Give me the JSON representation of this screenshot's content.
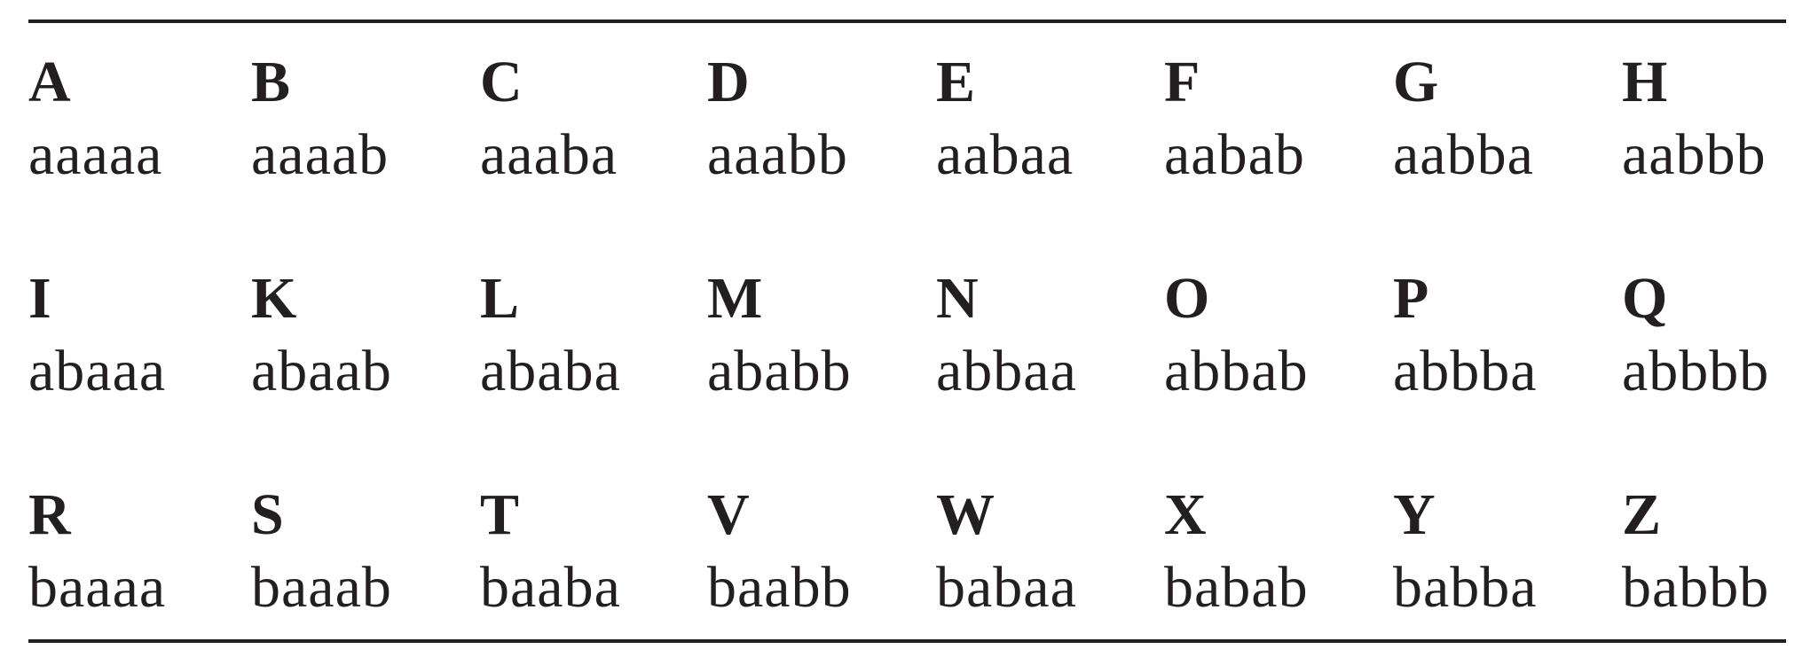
{
  "table": {
    "rows": [
      [
        {
          "letter": "A",
          "code": "aaaaa"
        },
        {
          "letter": "B",
          "code": "aaaab"
        },
        {
          "letter": "C",
          "code": "aaaba"
        },
        {
          "letter": "D",
          "code": "aaabb"
        },
        {
          "letter": "E",
          "code": "aabaa"
        },
        {
          "letter": "F",
          "code": "aabab"
        },
        {
          "letter": "G",
          "code": "aabba"
        },
        {
          "letter": "H",
          "code": "aabbb"
        }
      ],
      [
        {
          "letter": "I",
          "code": "abaaa"
        },
        {
          "letter": "K",
          "code": "abaab"
        },
        {
          "letter": "L",
          "code": "ababa"
        },
        {
          "letter": "M",
          "code": "ababb"
        },
        {
          "letter": "N",
          "code": "abbaa"
        },
        {
          "letter": "O",
          "code": "abbab"
        },
        {
          "letter": "P",
          "code": "abbba"
        },
        {
          "letter": "Q",
          "code": "abbbb"
        }
      ],
      [
        {
          "letter": "R",
          "code": "baaaa"
        },
        {
          "letter": "S",
          "code": "baaab"
        },
        {
          "letter": "T",
          "code": "baaba"
        },
        {
          "letter": "V",
          "code": "baabb"
        },
        {
          "letter": "W",
          "code": "babaa"
        },
        {
          "letter": "X",
          "code": "babab"
        },
        {
          "letter": "Y",
          "code": "babba"
        },
        {
          "letter": "Z",
          "code": "babbb"
        }
      ]
    ]
  }
}
